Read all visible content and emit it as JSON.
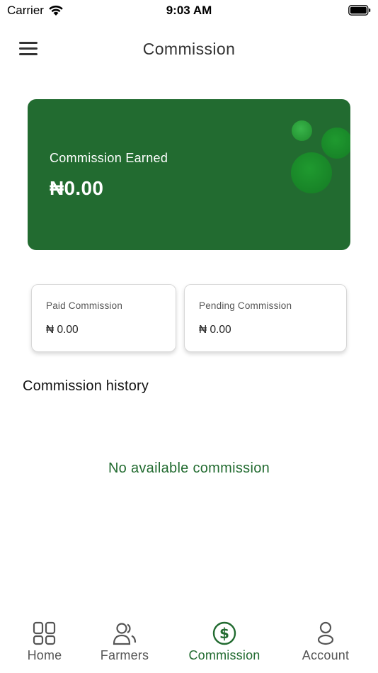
{
  "status_bar": {
    "carrier": "Carrier",
    "time": "9:03 AM"
  },
  "header": {
    "title": "Commission"
  },
  "earned": {
    "label": "Commission Earned",
    "value": "₦0.00"
  },
  "paid": {
    "label": "Paid Commission",
    "value": "₦ 0.00"
  },
  "pending": {
    "label": "Pending Commission",
    "value": "₦ 0.00"
  },
  "history": {
    "title": "Commission history",
    "empty_message": "No available commission"
  },
  "nav": {
    "items": [
      {
        "label": "Home",
        "icon": "grid-icon",
        "active": false
      },
      {
        "label": "Farmers",
        "icon": "users-icon",
        "active": false
      },
      {
        "label": "Commission",
        "icon": "dollar-circle-icon",
        "active": true
      },
      {
        "label": "Account",
        "icon": "user-icon",
        "active": false
      }
    ]
  },
  "colors": {
    "brand_green": "#226b30",
    "inactive_gray": "#555555"
  }
}
